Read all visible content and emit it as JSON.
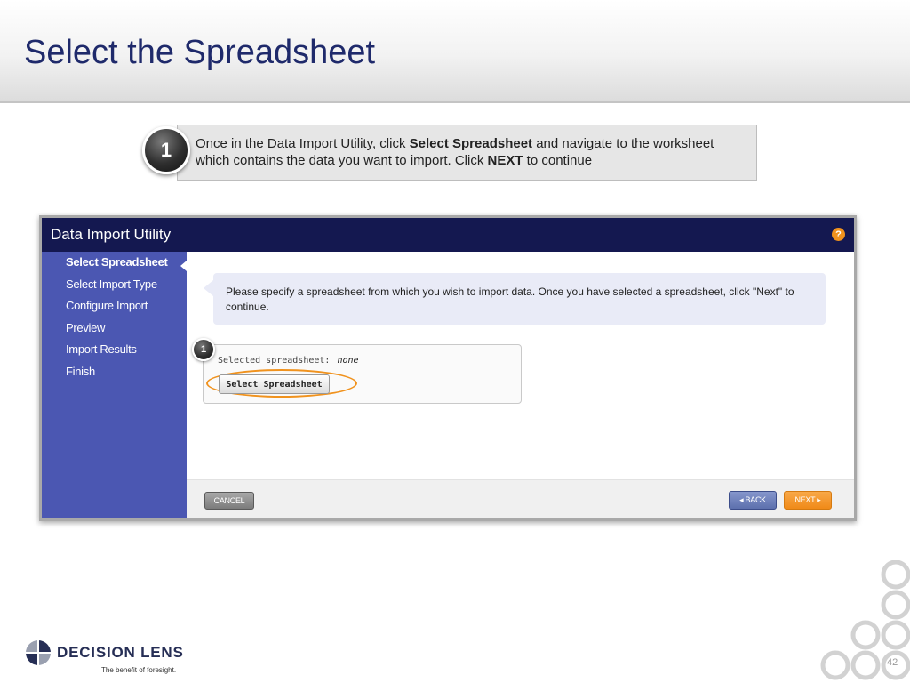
{
  "slide": {
    "title": "Select the Spreadsheet",
    "step_number": "1",
    "instruction": {
      "part1": "Once in the Data Import Utility, click ",
      "bold1": "Select Spreadsheet",
      "part2": " and navigate to the worksheet which contains the data  you want to import.  Click ",
      "bold2": "NEXT",
      "part3": " to continue"
    },
    "page_number": "42"
  },
  "app": {
    "title": "Data Import Utility",
    "help_icon": "help-icon",
    "sidebar": {
      "items": [
        {
          "label": "Select Spreadsheet",
          "active": true
        },
        {
          "label": "Select Import Type",
          "active": false
        },
        {
          "label": "Configure Import",
          "active": false
        },
        {
          "label": "Preview",
          "active": false
        },
        {
          "label": "Import Results",
          "active": false
        },
        {
          "label": "Finish",
          "active": false
        }
      ]
    },
    "info_text": "Please specify a spreadsheet from which you wish to import data. Once you have selected a spreadsheet, click \"Next\" to continue.",
    "step_badge": "1",
    "selected_label": "Selected spreadsheet:",
    "selected_value": "none",
    "select_button": "Select Spreadsheet",
    "cancel_button": "CANCEL",
    "back_button": "◂ BACK",
    "next_button": "NEXT ▸"
  },
  "branding": {
    "logo_text": "DECISION LENS",
    "tagline": "The benefit of foresight."
  },
  "colors": {
    "title_blue": "#1f2a6b",
    "app_titlebar": "#141850",
    "sidebar": "#4b57b2",
    "accent_orange": "#f0921d"
  }
}
